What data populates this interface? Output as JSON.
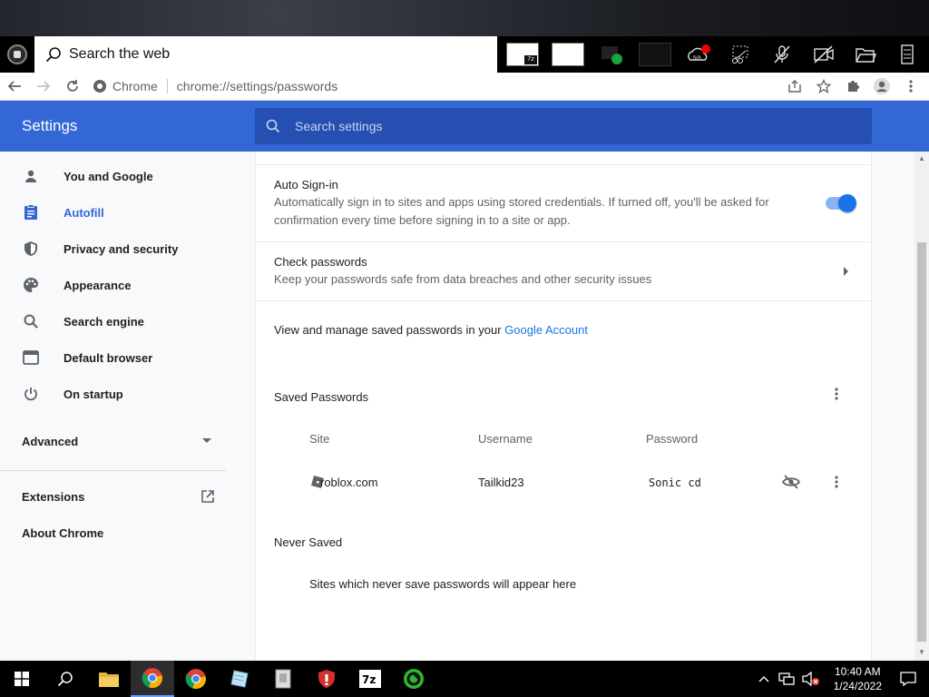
{
  "windows": {
    "search_placeholder": "Search the web",
    "clock_time": "10:40 AM",
    "clock_date": "1/24/2022",
    "tray_cloud_badge": "N/A"
  },
  "browser": {
    "site_label": "Chrome",
    "url": "chrome://settings/passwords"
  },
  "settings": {
    "title": "Settings",
    "search_placeholder": "Search settings",
    "sidebar": {
      "items": [
        {
          "label": "You and Google",
          "icon": "person-icon"
        },
        {
          "label": "Autofill",
          "icon": "clipboard-icon"
        },
        {
          "label": "Privacy and security",
          "icon": "shield-icon"
        },
        {
          "label": "Appearance",
          "icon": "palette-icon"
        },
        {
          "label": "Search engine",
          "icon": "search-icon"
        },
        {
          "label": "Default browser",
          "icon": "browser-icon"
        },
        {
          "label": "On startup",
          "icon": "power-icon"
        }
      ],
      "advanced": "Advanced",
      "extensions": "Extensions",
      "about": "About Chrome"
    },
    "passwords": {
      "auto_signin_title": "Auto Sign-in",
      "auto_signin_desc_1": "Automatically sign in to sites and apps using stored credentials. If turned off, you'll be asked for",
      "auto_signin_desc_2": "confirmation every time before signing in to a site or app.",
      "check_title": "Check passwords",
      "check_desc": "Keep your passwords safe from data breaches and other security issues",
      "manage_text": "View and manage saved passwords in your ",
      "manage_link": "Google Account",
      "saved_title": "Saved Passwords",
      "columns": {
        "site": "Site",
        "username": "Username",
        "password": "Password"
      },
      "entries": [
        {
          "site": "roblox.com",
          "username": "Tailkid23",
          "password": "Sonic cd"
        }
      ],
      "never_saved_title": "Never Saved",
      "never_saved_empty": "Sites which never save passwords will appear here"
    }
  },
  "colors": {
    "header_blue": "#3367d6",
    "active_blue": "#1a73e8"
  }
}
